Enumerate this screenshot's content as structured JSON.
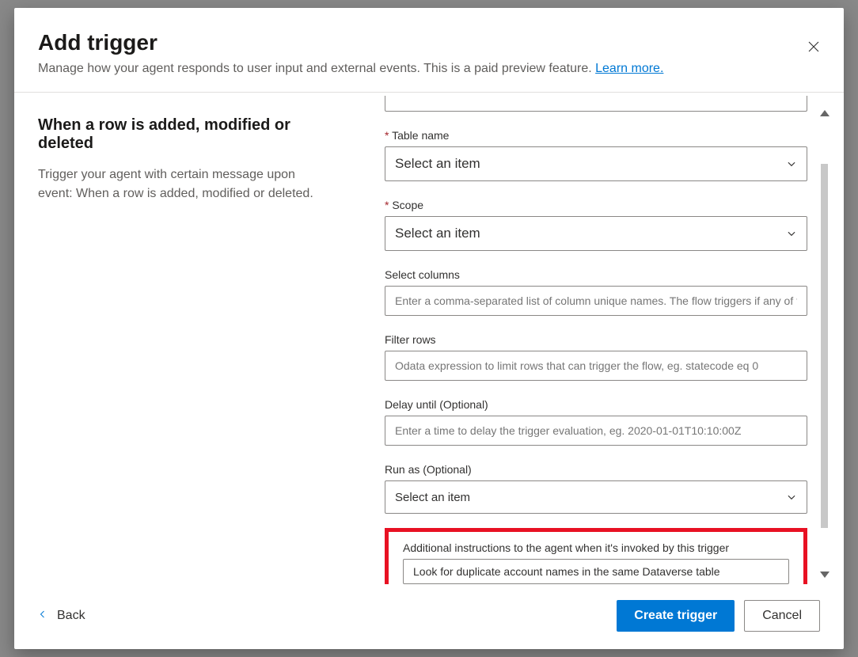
{
  "header": {
    "title": "Add trigger",
    "subtitle": "Manage how your agent responds to user input and external events. This is a paid preview feature. ",
    "learn_more": "Learn more."
  },
  "left": {
    "title": "When a row is added, modified or deleted",
    "description": "Trigger your agent with certain message upon event: When a row is added, modified or deleted."
  },
  "form": {
    "table_name": {
      "label": "Table name",
      "value": "Select an item"
    },
    "scope": {
      "label": "Scope",
      "value": "Select an item"
    },
    "select_columns": {
      "label": "Select columns",
      "placeholder": "Enter a comma-separated list of column unique names. The flow triggers if any of t"
    },
    "filter_rows": {
      "label": "Filter rows",
      "placeholder": "Odata expression to limit rows that can trigger the flow, eg. statecode eq 0"
    },
    "delay_until": {
      "label": "Delay until (Optional)",
      "placeholder": "Enter a time to delay the trigger evaluation, eg. 2020-01-01T10:10:00Z"
    },
    "run_as": {
      "label": "Run as (Optional)",
      "value": "Select an item"
    },
    "additional": {
      "label": "Additional instructions to the agent when it's invoked by this trigger",
      "value": "Look for duplicate account names in the same Dataverse table"
    }
  },
  "footer": {
    "back": "Back",
    "create": "Create trigger",
    "cancel": "Cancel"
  }
}
